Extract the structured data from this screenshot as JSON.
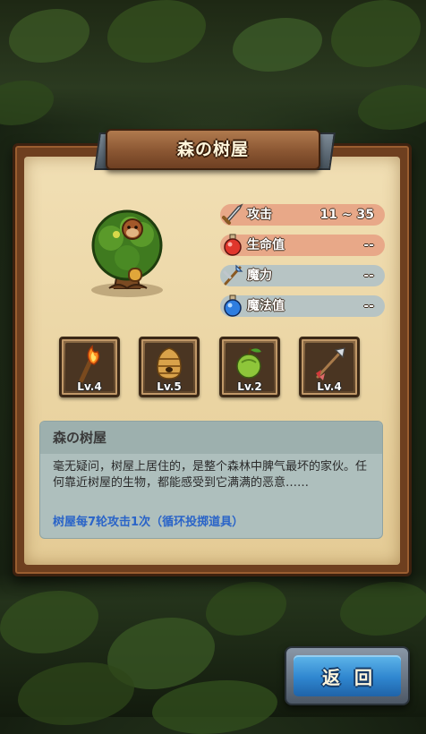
{
  "header": {
    "title": "森の树屋"
  },
  "stats": [
    {
      "icon": "sword-icon",
      "label": "攻击",
      "value": "11 ~ 35",
      "bar_color": "#e8a888"
    },
    {
      "icon": "health-potion-icon",
      "label": "生命值",
      "value": "--",
      "bar_color": "#e8a888"
    },
    {
      "icon": "magic-staff-icon",
      "label": "魔力",
      "value": "--",
      "bar_color": "#b7c4c4"
    },
    {
      "icon": "mana-potion-icon",
      "label": "魔法值",
      "value": "--",
      "bar_color": "#b7c4c4"
    }
  ],
  "items": [
    {
      "icon": "torch-icon",
      "level": "Lv.4"
    },
    {
      "icon": "beehive-icon",
      "level": "Lv.5"
    },
    {
      "icon": "green-fruit-icon",
      "level": "Lv.2"
    },
    {
      "icon": "arrow-icon",
      "level": "Lv.4"
    }
  ],
  "description": {
    "title": "森の树屋",
    "text": "毫无疑问，树屋上居住的，是整个森林中脾气最坏的家伙。任何靠近树屋的生物，都能感受到它满满的恶意……",
    "note": "树屋每7轮攻击1次（循环投掷道具）"
  },
  "buttons": {
    "back": "返回"
  },
  "colors": {
    "accent_blue": "#2f86cf",
    "note_blue": "#2a64c8",
    "parchment": "#ead4a2"
  }
}
